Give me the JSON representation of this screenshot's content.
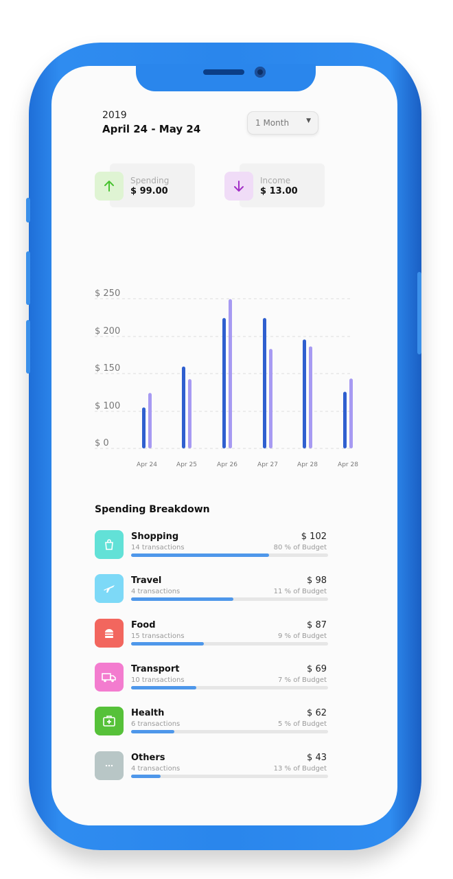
{
  "header": {
    "year": "2019",
    "date_range": "April 24 - May 24"
  },
  "period_select": {
    "selected": "1 Month"
  },
  "summary": [
    {
      "label": "Spending",
      "value": "$ 99.00",
      "icon": "arrow-up-icon",
      "bg": "#dff4d3",
      "fg": "#48c230"
    },
    {
      "label": "Income",
      "value": "$ 13.00",
      "icon": "arrow-down-icon",
      "bg": "#f0dcf7",
      "fg": "#a22fc6"
    }
  ],
  "chart_data": {
    "type": "bar",
    "categories": [
      "Apr 24",
      "Apr 25",
      "Apr 26",
      "Apr 27",
      "Apr 28",
      "Apr 28"
    ],
    "series": [
      {
        "values": [
          65,
          130,
          207,
          207,
          173,
          90
        ],
        "color": "#2f5fcf"
      },
      {
        "values": [
          88,
          110,
          237,
          158,
          162,
          111
        ],
        "color": "#a79af2"
      }
    ],
    "y_ticks": [
      "$ 0",
      "$ 100",
      "$ 150",
      "$ 200",
      "$ 250"
    ],
    "grid": true
  },
  "breakdown": {
    "title": "Spending Breakdown",
    "items": [
      {
        "name": "Shopping",
        "transactions": "14 transactions",
        "amount": "$ 102",
        "budget": "80 % of Budget",
        "progress": 0.7,
        "icon": "shopping-bag-icon",
        "color": "#62e1d7"
      },
      {
        "name": "Travel",
        "transactions": "4 transactions",
        "amount": "$ 98",
        "budget": "11 % of Budget",
        "progress": 0.52,
        "icon": "airplane-icon",
        "color": "#7dd9f7"
      },
      {
        "name": "Food",
        "transactions": "15 transactions",
        "amount": "$ 87",
        "budget": "9 % of Budget",
        "progress": 0.37,
        "icon": "burger-icon",
        "color": "#f2665e"
      },
      {
        "name": "Transport",
        "transactions": "10 transactions",
        "amount": "$ 69",
        "budget": "7 % of Budget",
        "progress": 0.33,
        "icon": "truck-icon",
        "color": "#f37ccf"
      },
      {
        "name": "Health",
        "transactions": "6 transactions",
        "amount": "$ 62",
        "budget": "5 % of Budget",
        "progress": 0.22,
        "icon": "first-aid-icon",
        "color": "#56c139"
      },
      {
        "name": "Others",
        "transactions": "4 transactions",
        "amount": "$ 43",
        "budget": "13 % of Budget",
        "progress": 0.15,
        "icon": "more-dots-icon",
        "color": "#b8c6c6"
      }
    ]
  }
}
